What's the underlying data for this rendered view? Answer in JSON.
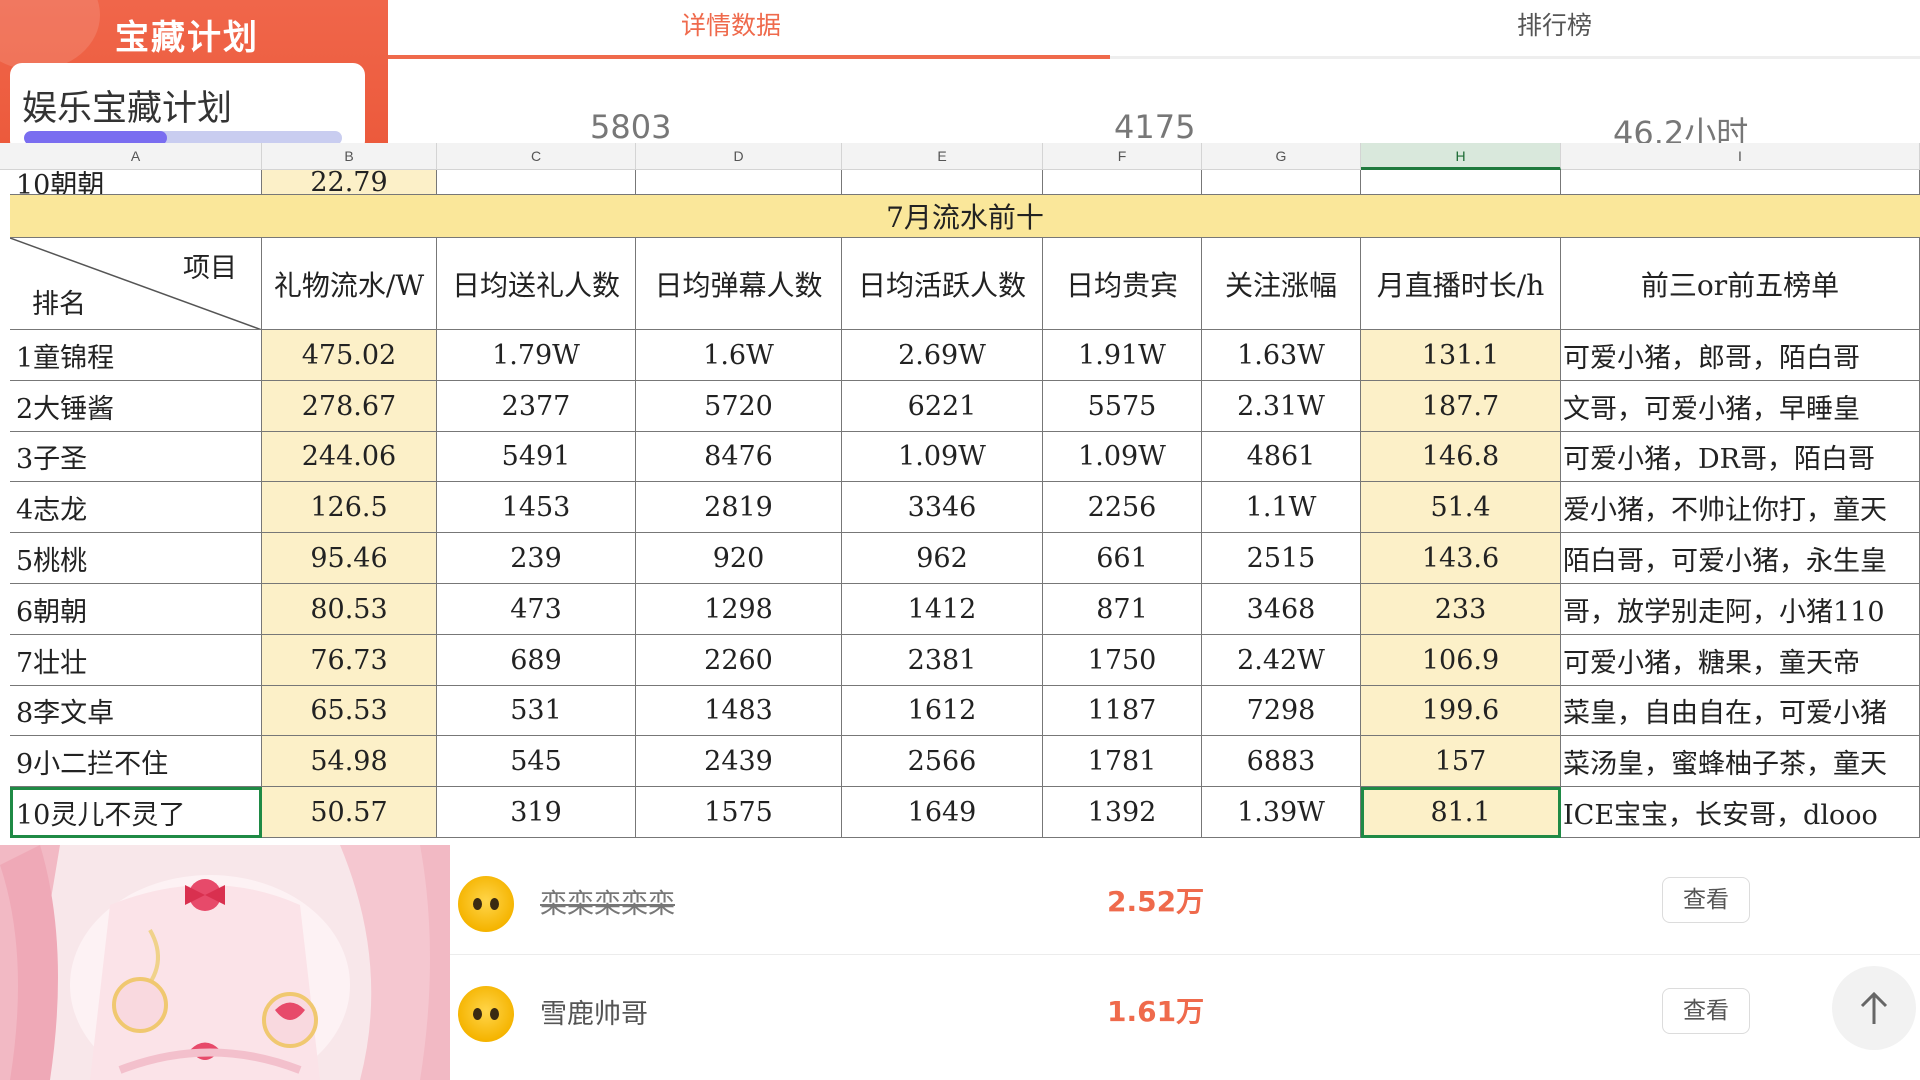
{
  "app": {
    "banner_title": "宝藏计划",
    "plan_name": "娱乐宝藏计划",
    "plan_progress": 0.45
  },
  "tabs": [
    {
      "label": "详情数据",
      "active": true
    },
    {
      "label": "排行榜",
      "active": false
    }
  ],
  "stats": [
    "5803",
    "4175",
    "46.2小时"
  ],
  "sheet": {
    "columns": [
      "A",
      "B",
      "C",
      "D",
      "E",
      "F",
      "G",
      "H",
      "I"
    ],
    "selected_column": "H",
    "partial_row": {
      "name": "10朝朝",
      "value": "22.79"
    },
    "title": "7月流水前十",
    "corner_top": "项目",
    "corner_bottom": "排名",
    "headers": [
      "礼物流水/W",
      "日均送礼人数",
      "日均弹幕人数",
      "日均活跃人数",
      "日均贵宾",
      "关注涨幅",
      "月直播时长/h",
      "前三or前五榜单"
    ],
    "rows": [
      [
        "1童锦程",
        "475.02",
        "1.79W",
        "1.6W",
        "2.69W",
        "1.91W",
        "1.63W",
        "131.1",
        "可爱小猪，郎哥，陌白哥"
      ],
      [
        "2大锤酱",
        "278.67",
        "2377",
        "5720",
        "6221",
        "5575",
        "2.31W",
        "187.7",
        "文哥，可爱小猪，早睡皇"
      ],
      [
        "3子圣",
        "244.06",
        "5491",
        "8476",
        "1.09W",
        "1.09W",
        "4861",
        "146.8",
        "可爱小猪，DR哥，陌白哥"
      ],
      [
        "4志龙",
        "126.5",
        "1453",
        "2819",
        "3346",
        "2256",
        "1.1W",
        "51.4",
        "爱小猪，不帅让你打，童天"
      ],
      [
        "5桃桃",
        "95.46",
        "239",
        "920",
        "962",
        "661",
        "2515",
        "143.6",
        "陌白哥，可爱小猪，永生皇"
      ],
      [
        "6朝朝",
        "80.53",
        "473",
        "1298",
        "1412",
        "871",
        "3468",
        "233",
        "哥，放学别走阿，小猪110"
      ],
      [
        "7壮壮",
        "76.73",
        "689",
        "2260",
        "2381",
        "1750",
        "2.42W",
        "106.9",
        "可爱小猪，糖果，童天帝"
      ],
      [
        "8李文卓",
        "65.53",
        "531",
        "1483",
        "1612",
        "1187",
        "7298",
        "199.6",
        "菜皇，自由自在，可爱小猪"
      ],
      [
        "9小二拦不住",
        "54.98",
        "545",
        "2439",
        "2566",
        "1781",
        "6883",
        "157",
        "菜汤皇，蜜蜂柚子茶，童天"
      ],
      [
        "10灵儿不灵了",
        "50.57",
        "319",
        "1575",
        "1649",
        "1392",
        "1.39W",
        "81.1",
        "ICE宝宝，长安哥，dlooo"
      ]
    ]
  },
  "ranking": [
    {
      "name": "栾栾栾栾栾",
      "amount": "2.52万",
      "button": "查看",
      "avatar": "cat-avatar-icon"
    },
    {
      "name": "雪鹿帅哥",
      "amount": "1.61万",
      "button": "查看",
      "avatar": "cat-avatar-icon"
    }
  ],
  "colors": {
    "accent": "#ef6a4c",
    "title_bar": "#fae79a",
    "highlight_col": "#fcf0c8",
    "selection": "#1f8a45"
  }
}
